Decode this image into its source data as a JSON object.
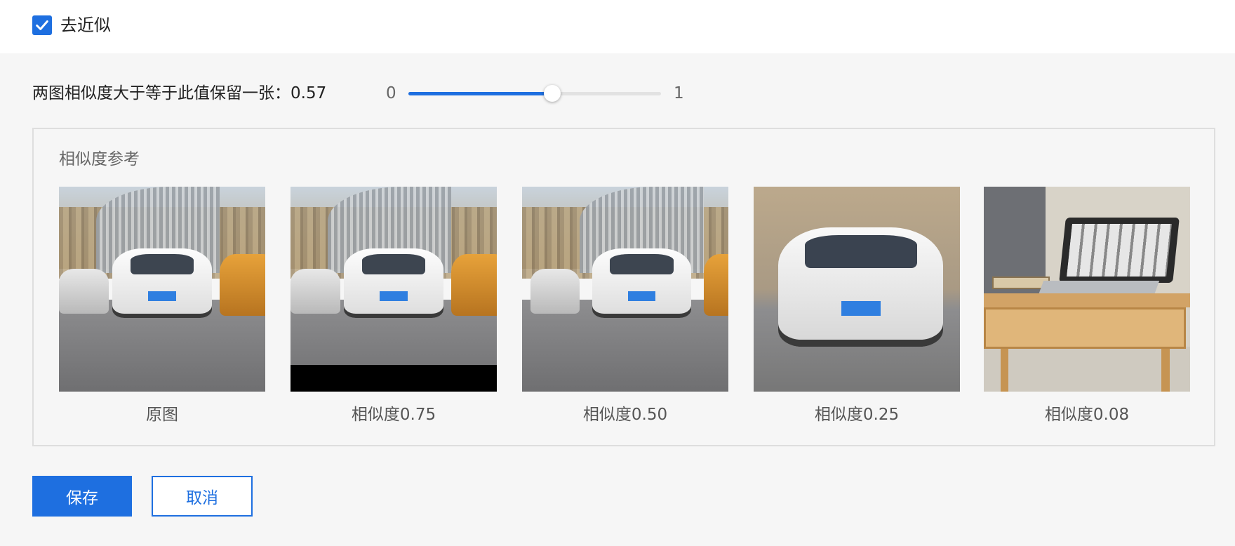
{
  "dedupe": {
    "label": "去近似",
    "checked": true
  },
  "threshold": {
    "label": "两图相似度大于等于此值保留一张：",
    "value": "0.57",
    "value_num": 0.57,
    "min_label": "0",
    "max_label": "1",
    "min": 0,
    "max": 1
  },
  "reference": {
    "title": "相似度参考",
    "items": [
      {
        "caption": "原图",
        "image": "street-cars-photo"
      },
      {
        "caption": "相似度0.75",
        "image": "street-cars-cropped-photo"
      },
      {
        "caption": "相似度0.50",
        "image": "street-cars-shifted-photo"
      },
      {
        "caption": "相似度0.25",
        "image": "white-car-closeup-photo"
      },
      {
        "caption": "相似度0.08",
        "image": "laptop-on-table-photo"
      }
    ]
  },
  "actions": {
    "save_label": "保存",
    "cancel_label": "取消"
  },
  "colors": {
    "accent": "#1e6fe0",
    "track": "#e2e2e2",
    "panel_border": "#dedede"
  }
}
